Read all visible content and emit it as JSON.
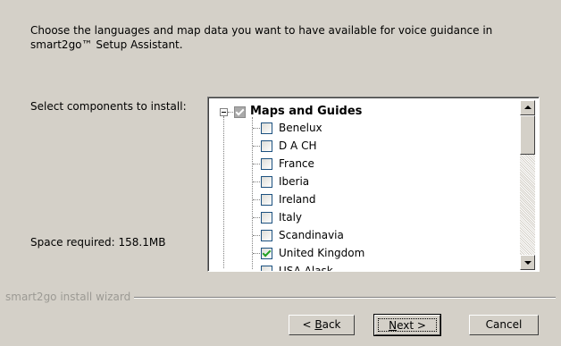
{
  "description": "Choose the languages and map data you want to have available for voice guidance in smart2go™ Setup Assistant.",
  "select_label": "Select components to install:",
  "space_required": "Space required: 158.1MB",
  "tree": {
    "root": {
      "label": "Maps and Guides",
      "checked": "partial"
    },
    "items": [
      {
        "label": "Benelux",
        "checked": false
      },
      {
        "label": "D A CH",
        "checked": false
      },
      {
        "label": "France",
        "checked": false
      },
      {
        "label": "Iberia",
        "checked": false
      },
      {
        "label": "Ireland",
        "checked": false
      },
      {
        "label": "Italy",
        "checked": false
      },
      {
        "label": "Scandinavia",
        "checked": false
      },
      {
        "label": "United Kingdom",
        "checked": true
      },
      {
        "label": "USA Alask",
        "checked": false
      }
    ]
  },
  "footer_label": "smart2go install wizard",
  "buttons": {
    "back": {
      "prefix": "< ",
      "mnemonic": "B",
      "rest": "ack"
    },
    "next": {
      "mnemonic": "N",
      "rest": "ext >"
    },
    "cancel": "Cancel"
  },
  "colors": {
    "background": "#d4d0c8",
    "check_green": "#21a121",
    "checkbox_border": "#1c5180"
  },
  "icons": {
    "expander": "minus-box-icon",
    "scroll_up": "arrow-up-icon",
    "scroll_down": "arrow-down-icon"
  }
}
